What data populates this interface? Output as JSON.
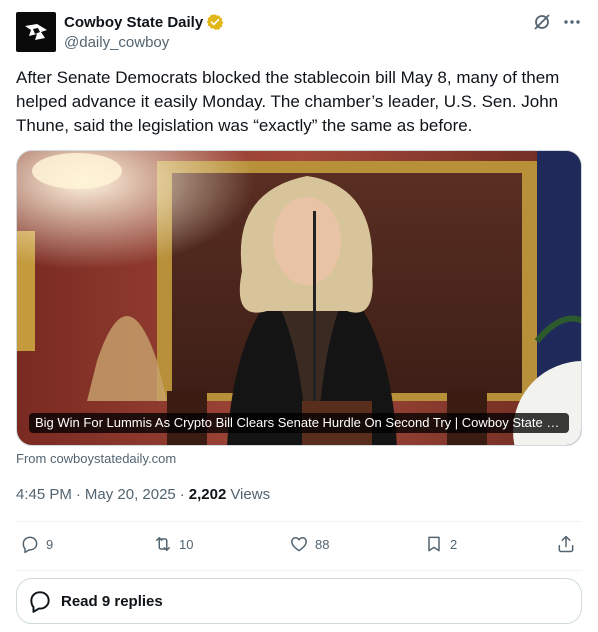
{
  "author": {
    "display_name": "Cowboy State Daily",
    "handle": "@daily_cowboy",
    "verified_color": "#e2b719"
  },
  "tweet": {
    "text": "After Senate Democrats blocked the stablecoin bill May 8, many of them helped advance it easily Monday. The chamber’s leader, U.S. Sen. John Thune, said the legislation was “exactly” the same as before."
  },
  "card": {
    "caption": "Big Win For Lummis As Crypto Bill Clears Senate Hurdle On Second Try | Cowboy State Daily",
    "source": "From cowboystatedaily.com"
  },
  "meta": {
    "time": "4:45 PM",
    "date": "May 20, 2025",
    "views": "2,202",
    "views_label": "Views"
  },
  "actions": {
    "replies": "9",
    "reposts": "10",
    "likes": "88",
    "bookmarks": "2"
  },
  "read_replies": "Read 9 replies",
  "icons": {
    "more": "more-icon",
    "grok": "grok-icon",
    "reply": "reply-icon",
    "repost": "repost-icon",
    "like": "like-icon",
    "bookmark": "bookmark-icon",
    "share": "share-icon"
  }
}
